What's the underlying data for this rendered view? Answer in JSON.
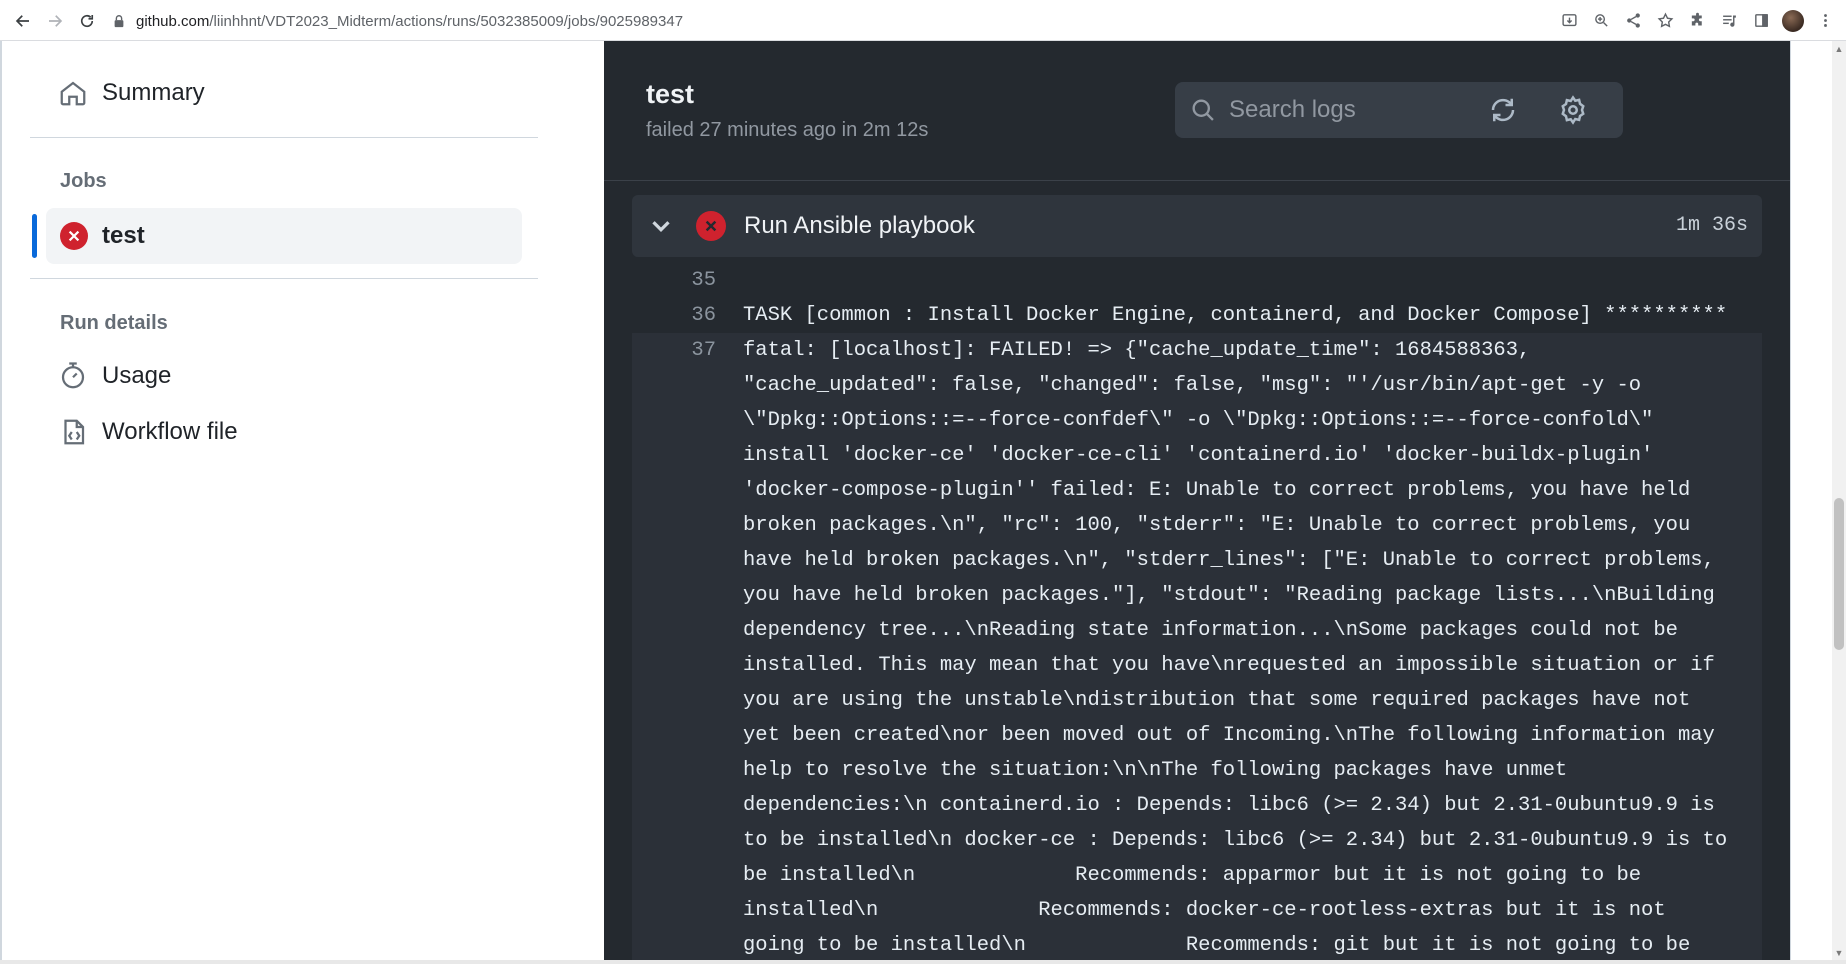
{
  "browser": {
    "url_host": "github.com",
    "url_path": "/liinhhnt/VDT2023_Midterm/actions/runs/5032385009/jobs/9025989347"
  },
  "sidebar": {
    "summary_label": "Summary",
    "jobs_heading": "Jobs",
    "jobs": [
      {
        "label": "test",
        "status": "failed",
        "selected": true
      }
    ],
    "run_details_heading": "Run details",
    "run_details": [
      {
        "label": "Usage",
        "icon": "stopwatch-icon"
      },
      {
        "label": "Workflow file",
        "icon": "workflow-file-icon"
      }
    ]
  },
  "panel": {
    "job_title": "test",
    "job_status": "failed 27 minutes ago in 2m 12s",
    "search_placeholder": "Search logs",
    "step": {
      "title": "Run Ansible playbook",
      "duration": "1m 36s",
      "status": "failed"
    },
    "log_lines": [
      {
        "no": "35",
        "text": ""
      },
      {
        "no": "36",
        "text": "TASK [common : Install Docker Engine, containerd, and Docker Compose] **********"
      },
      {
        "no": "37",
        "text": "fatal: [localhost]: FAILED! => {\"cache_update_time\": 1684588363,\n\"cache_updated\": false, \"changed\": false, \"msg\": \"'/usr/bin/apt-get -y -o\n\\\"Dpkg::Options::=--force-confdef\\\" -o \\\"Dpkg::Options::=--force-confold\\\"\ninstall 'docker-ce' 'docker-ce-cli' 'containerd.io' 'docker-buildx-plugin'\n'docker-compose-plugin'' failed: E: Unable to correct problems, you have held\nbroken packages.\\n\", \"rc\": 100, \"stderr\": \"E: Unable to correct problems, you\nhave held broken packages.\\n\", \"stderr_lines\": [\"E: Unable to correct problems,\nyou have held broken packages.\"], \"stdout\": \"Reading package lists...\\nBuilding\ndependency tree...\\nReading state information...\\nSome packages could not be\ninstalled. This may mean that you have\\nrequested an impossible situation or if\nyou are using the unstable\\ndistribution that some required packages have not\nyet been created\\nor been moved out of Incoming.\\nThe following information may\nhelp to resolve the situation:\\n\\nThe following packages have unmet\ndependencies:\\n containerd.io : Depends: libc6 (>= 2.34) but 2.31-0ubuntu9.9 is\nto be installed\\n docker-ce : Depends: libc6 (>= 2.34) but 2.31-0ubuntu9.9 is to\nbe installed\\n             Recommends: apparmor but it is not going to be\ninstalled\\n             Recommends: docker-ce-rootless-extras but it is not\ngoing to be installed\\n             Recommends: git but it is not going to be",
        "highlight": true
      }
    ]
  },
  "colors": {
    "panel_bg": "#24292f",
    "step_bg": "#2f353d",
    "fail_red": "#cf222e",
    "accent_blue": "#0969da"
  }
}
